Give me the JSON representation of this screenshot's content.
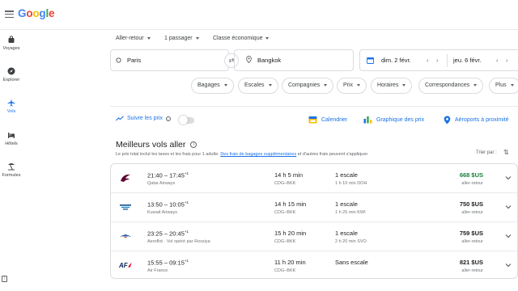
{
  "app": {
    "logo": "Google"
  },
  "sidenav": [
    {
      "label": "Voyages",
      "icon": "suitcase-icon"
    },
    {
      "label": "Explorer",
      "icon": "compass-icon"
    },
    {
      "label": "Vols",
      "icon": "airplane-icon",
      "active": true
    },
    {
      "label": "Hôtels",
      "icon": "bed-icon"
    },
    {
      "label": "Formules",
      "icon": "vacation-icon"
    }
  ],
  "bottom_badge": "!",
  "search": {
    "trip_type": "Aller-retour",
    "passengers": "1 passager",
    "cabin": "Classe économique",
    "origin": "Paris",
    "destination": "Bangkok",
    "depart_date": "dim. 2 févr.",
    "return_date": "jeu. 6 févr."
  },
  "filters": [
    "Bagages",
    "Escales",
    "Compagnies",
    "Prix",
    "Horaires",
    "Correspondances",
    "Plus"
  ],
  "tools": {
    "track_prices": "Suivre les prix",
    "calendar": "Calendrier",
    "price_graph": "Graphique des prix",
    "nearby_airports": "Aéroports à proximité"
  },
  "section": {
    "title": "Meilleurs vols aller",
    "subtitle_before": "Le prix total inclut les taxes et les frais pour 1 adulte. ",
    "subtitle_link": "Des frais de bagages supplémentaires",
    "subtitle_after": " et d'autres frais peuvent s'appliquer.",
    "sort_label": "Trier par :"
  },
  "flights": [
    {
      "depart": "21:40",
      "arrive": "17:45",
      "day_offset": "+1",
      "airline": "Qatar Airways",
      "duration": "14 h 5 min",
      "route": "CDG–BKK",
      "stops": "1 escale",
      "stop_detail": "1 h 10 min DOH",
      "price": "668 $US",
      "price_type": "aller-retour",
      "best_price": true
    },
    {
      "depart": "13:50",
      "arrive": "10:05",
      "day_offset": "+1",
      "airline": "Kuwait Airways",
      "duration": "14 h 15 min",
      "route": "CDG–BKK",
      "stops": "1 escale",
      "stop_detail": "1 h 25 min KWI",
      "price": "750 $US",
      "price_type": "aller-retour",
      "best_price": false
    },
    {
      "depart": "23:25",
      "arrive": "20:45",
      "day_offset": "+1",
      "airline": "Aeroflot · Vol opéré par Rossiya",
      "duration": "15 h 20 min",
      "route": "CDG–BKK",
      "stops": "1 escale",
      "stop_detail": "2 h 20 min SVO",
      "price": "759 $US",
      "price_type": "aller-retour",
      "best_price": false
    },
    {
      "depart": "15:55",
      "arrive": "09:15",
      "day_offset": "+1",
      "airline": "Air France",
      "duration": "11 h 20 min",
      "route": "CDG–BKK",
      "stops": "Sans escale",
      "stop_detail": "",
      "price": "821 $US",
      "price_type": "aller-retour",
      "best_price": false
    }
  ],
  "colors": {
    "accent": "#1a73e8",
    "best_price": "#188038",
    "border": "#dadce0"
  }
}
